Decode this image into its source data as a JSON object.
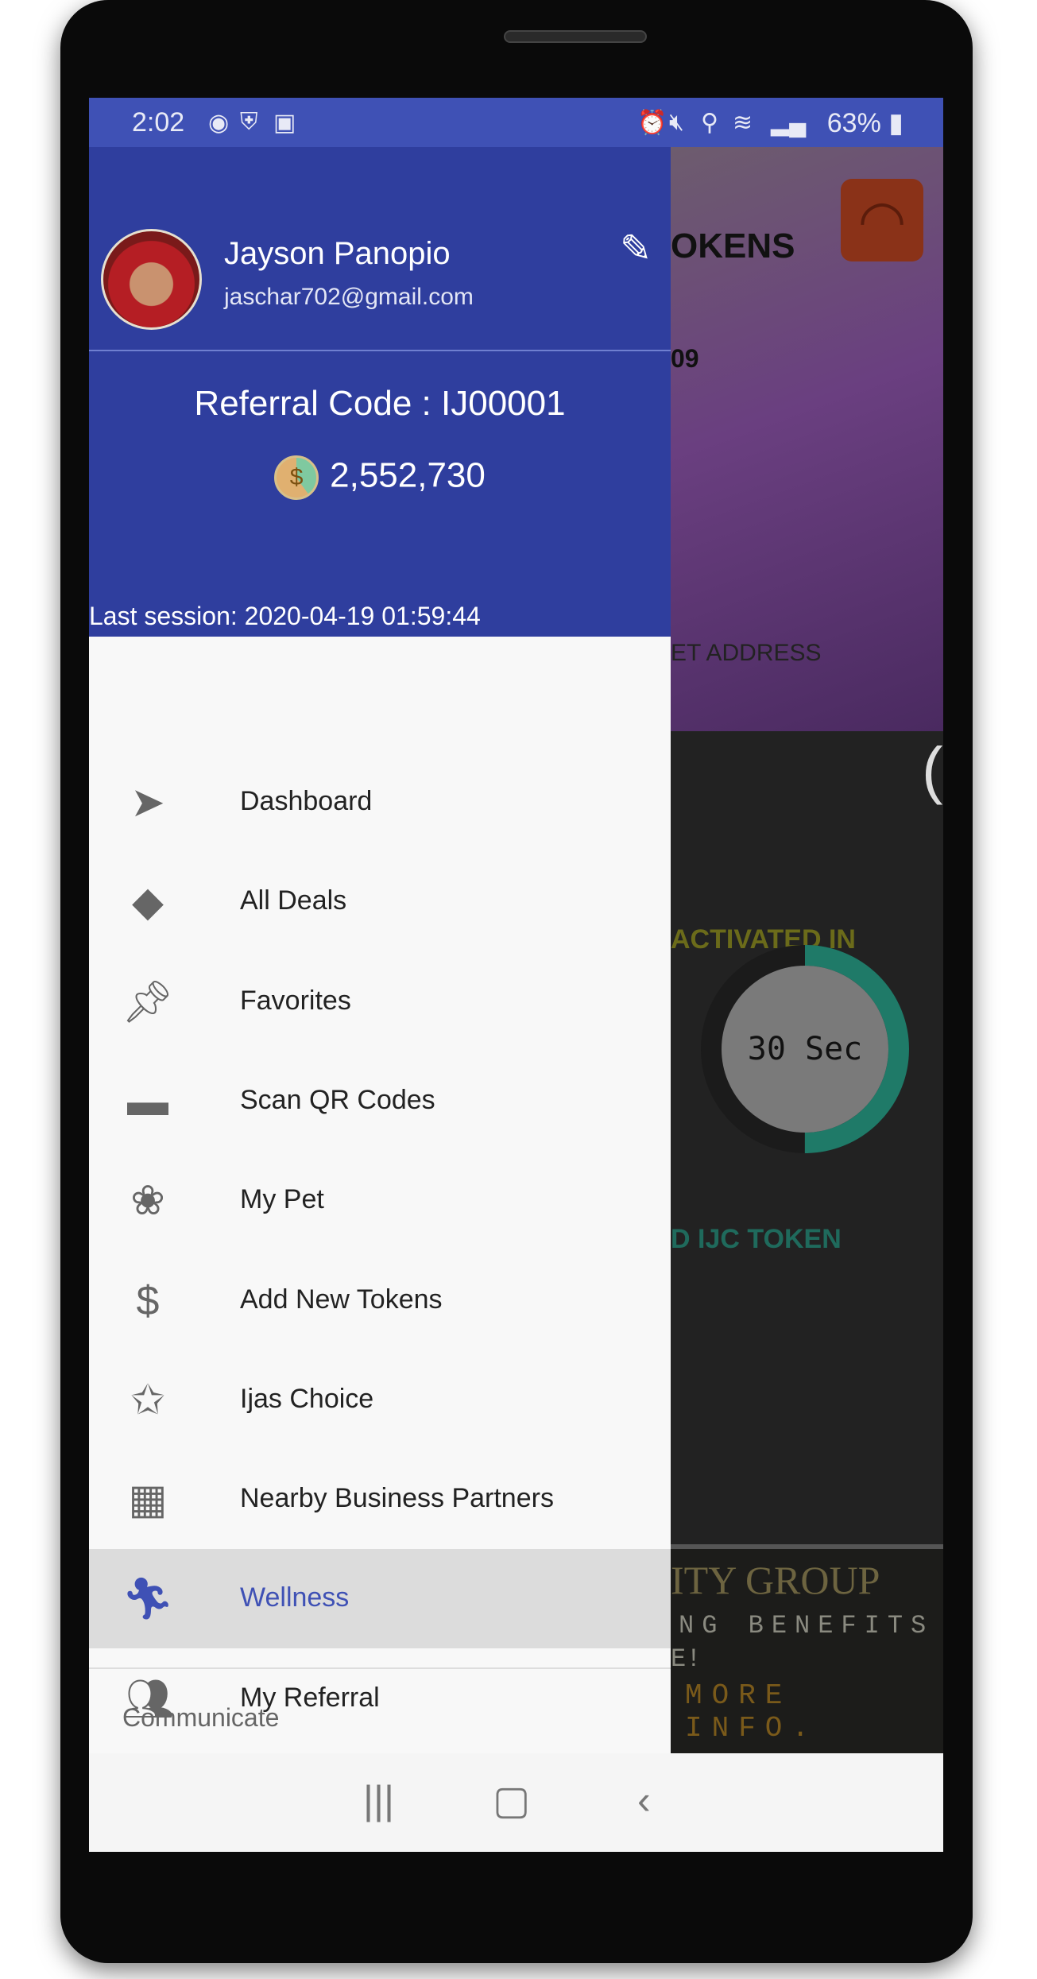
{
  "status_bar": {
    "time": "2:02",
    "left_icons": [
      "messenger-icon",
      "vpn-shield-icon",
      "gallery-icon"
    ],
    "right_icons": [
      "alarm-icon",
      "mute-icon",
      "location-icon",
      "wifi-icon",
      "signal-icon"
    ],
    "battery": "63%"
  },
  "drawer": {
    "profile": {
      "name": "Jayson Panopio",
      "email": "jaschar702@gmail.com"
    },
    "referral_code": "Referral Code : IJ00001",
    "token_balance": "2,552,730",
    "last_session": "Last session: 2020-04-19 01:59:44",
    "items": [
      {
        "label": "Dashboard",
        "icon": "navigation-arrow-icon"
      },
      {
        "label": "All Deals",
        "icon": "tag-icon"
      },
      {
        "label": "Favorites",
        "icon": "pin-icon"
      },
      {
        "label": "Scan QR Codes",
        "icon": "scan-icon"
      },
      {
        "label": "My Pet",
        "icon": "paw-icon"
      },
      {
        "label": "Add New Tokens",
        "icon": "dollar-coin-icon"
      },
      {
        "label": "Ijas Choice",
        "icon": "bookmark-star-icon"
      },
      {
        "label": "Nearby Business Partners",
        "icon": "buildings-icon"
      },
      {
        "label": "Wellness",
        "icon": "running-icon",
        "selected": true
      },
      {
        "label": "My Referral",
        "icon": "group-icon"
      }
    ],
    "section_header": "Communicate"
  },
  "background": {
    "title_fragment": "OKENS",
    "number_fragment": "09",
    "address_fragment": "ET ADDRESS",
    "activated_text": "ACTIVATED IN",
    "timer": "30 Sec",
    "timer_progress": 0.5,
    "token_text": "D IJC TOKEN",
    "banner_lines": [
      "ITY GROUP",
      "NG BENEFITS",
      "E!",
      "MORE INFO."
    ]
  },
  "colors": {
    "primary": "#3f51b5",
    "drawer_header": "#2f3e9e",
    "timer_ring": "#1f7a68",
    "selected_bg": "#dcdcdc"
  }
}
